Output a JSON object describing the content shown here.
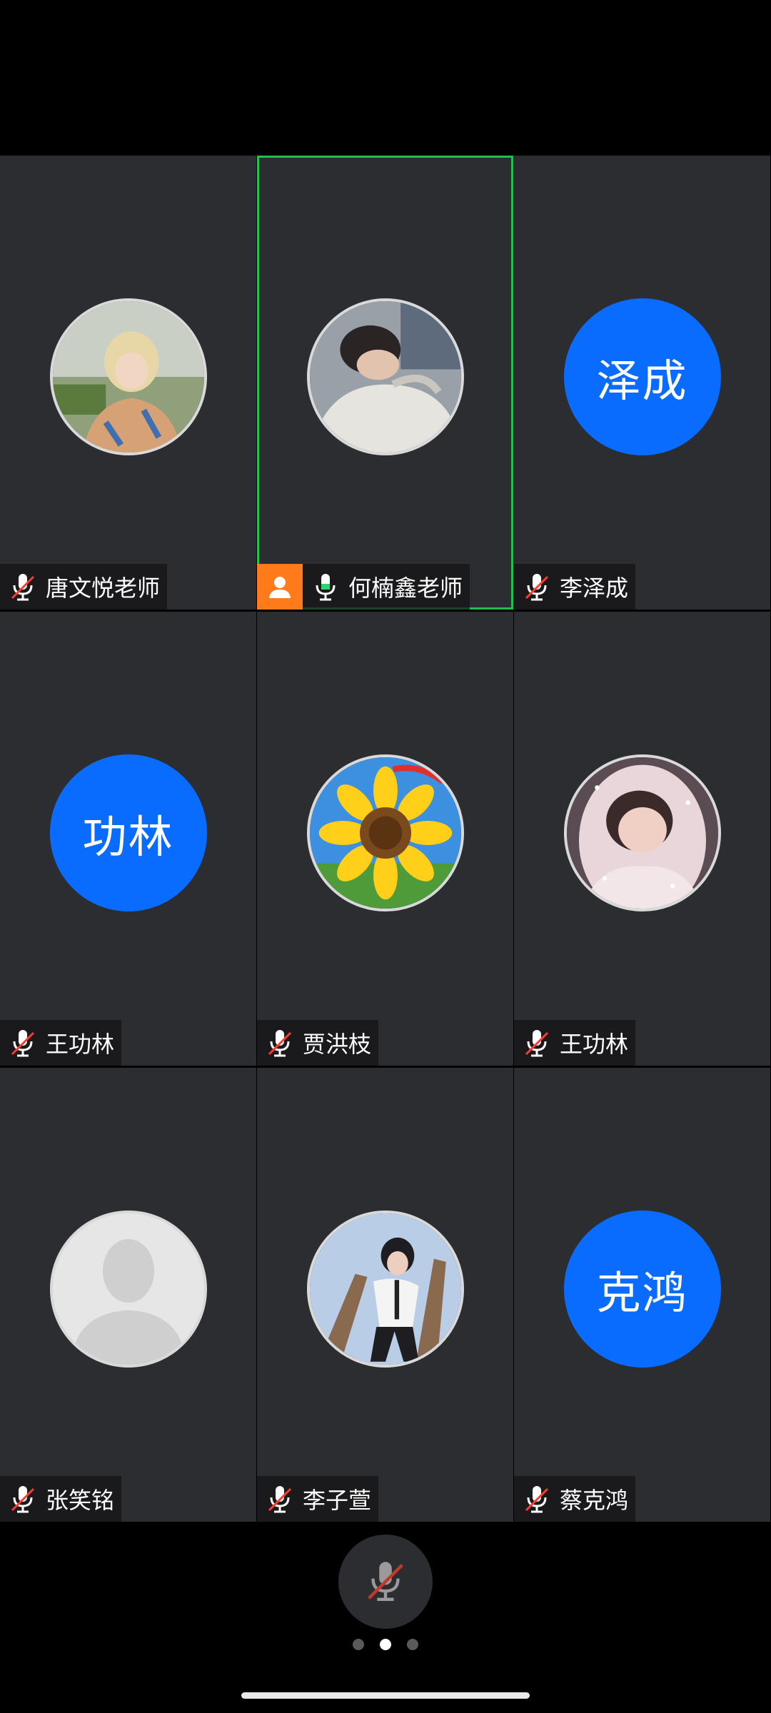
{
  "participants": [
    {
      "name": "唐文悦老师",
      "avatar": "photo-blond-person",
      "muted": true,
      "host": false,
      "active": false
    },
    {
      "name": "何楠鑫老师",
      "avatar": "photo-person-sleeping",
      "muted": false,
      "host": true,
      "active": true
    },
    {
      "name": "李泽成",
      "avatar_text": "泽成",
      "muted": true,
      "host": false,
      "active": false
    },
    {
      "name": "王功林",
      "avatar_text": "功林",
      "muted": true,
      "host": false,
      "active": false
    },
    {
      "name": "贾洪枝",
      "avatar": "photo-sunflower",
      "muted": true,
      "host": false,
      "active": false
    },
    {
      "name": "王功林",
      "avatar": "photo-woman-hood",
      "muted": true,
      "host": false,
      "active": false
    },
    {
      "name": "张笑铭",
      "avatar": "default-person",
      "muted": true,
      "host": false,
      "active": false
    },
    {
      "name": "李子萱",
      "avatar": "photo-person-tree",
      "muted": true,
      "host": false,
      "active": false
    },
    {
      "name": "蔡克鸿",
      "avatar_text": "克鸿",
      "muted": true,
      "host": false,
      "active": false
    }
  ],
  "controls": {
    "mic_state": "muted"
  },
  "pagination": {
    "pages": 3,
    "current": 2
  },
  "colors": {
    "active_border": "#1fc24f",
    "avatar_blue": "#0a6cff",
    "host_badge": "#ff7a1a",
    "muted_slash": "#ff3b30"
  }
}
